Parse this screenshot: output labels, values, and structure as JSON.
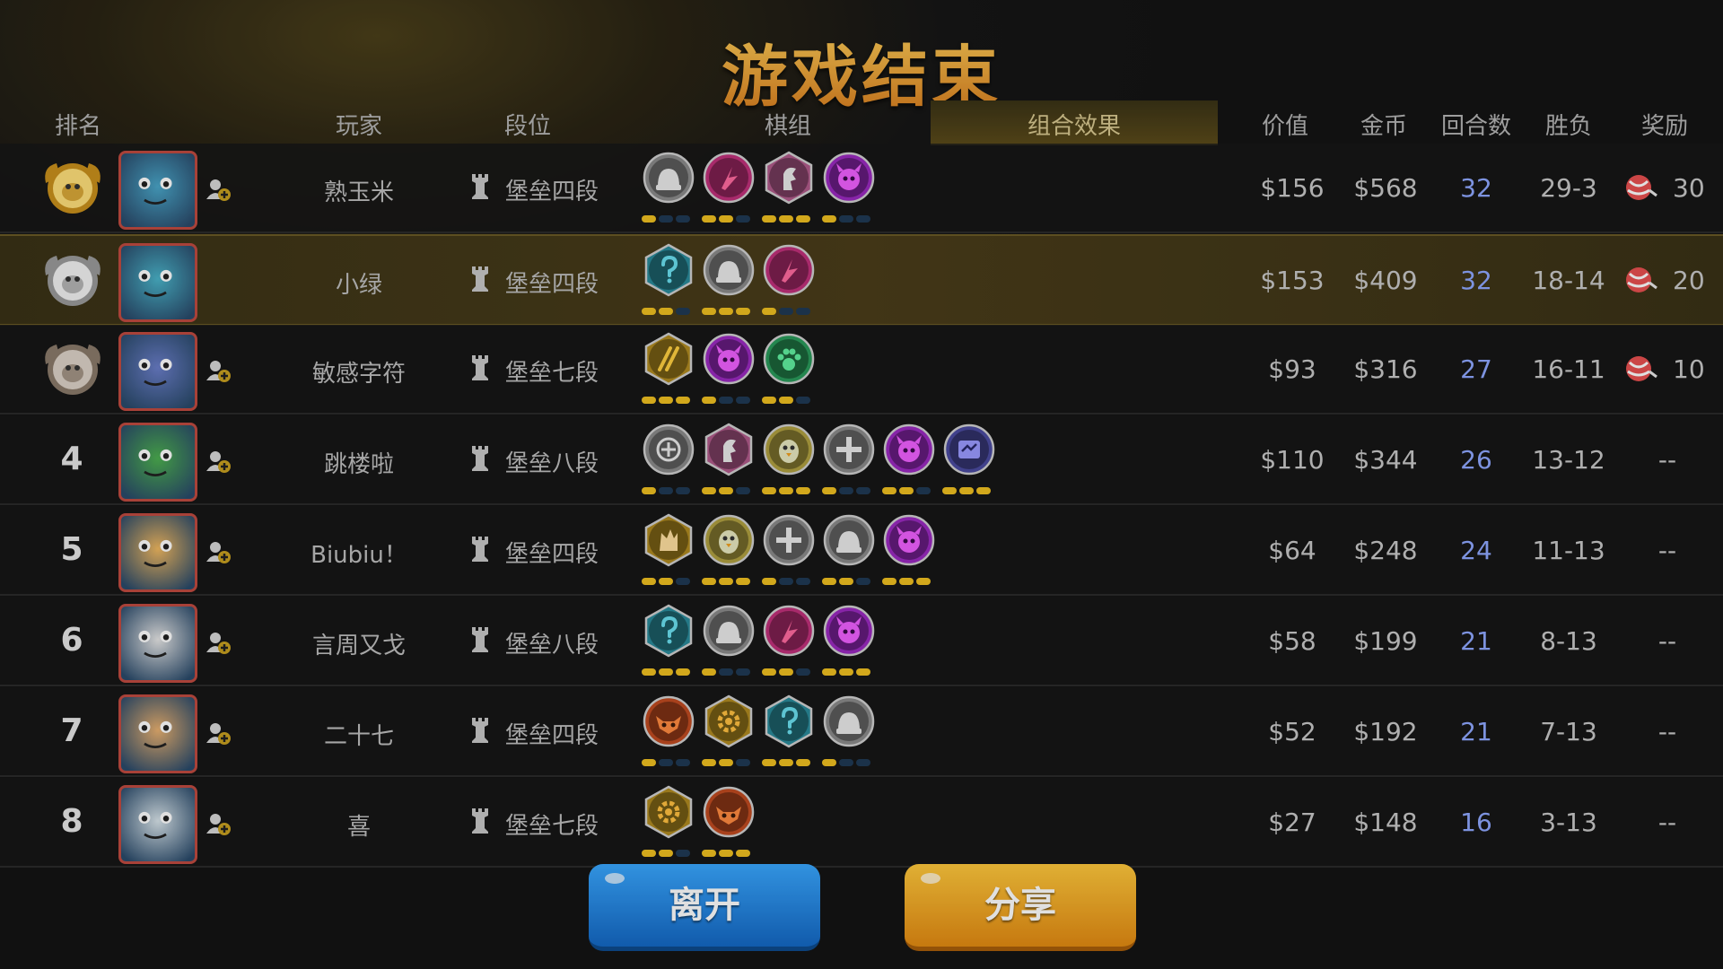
{
  "title": "游戏结束",
  "columns": {
    "rank": "排名",
    "player": "玩家",
    "tier": "段位",
    "lineup": "棋组",
    "synergy": "组合效果",
    "value": "价值",
    "gold": "金币",
    "rounds": "回合数",
    "record": "胜负",
    "reward": "奖励"
  },
  "players": [
    {
      "rank": "",
      "medal": "gold-medal",
      "name": "熟玉米",
      "tier": "堡垒四段",
      "value": "$156",
      "gold": "$568",
      "rounds": "32",
      "record": "29-3",
      "reward": "30",
      "friend": true,
      "avatar_color": "#4aa6c9"
    },
    {
      "rank": "",
      "medal": "silver-medal",
      "name": "小绿",
      "tier": "堡垒四段",
      "value": "$153",
      "gold": "$409",
      "rounds": "32",
      "record": "18-14",
      "reward": "20",
      "friend": false,
      "avatar_color": "#4ab3c9"
    },
    {
      "rank": "",
      "medal": "bronze-medal",
      "name": "敏感字符",
      "tier": "堡垒七段",
      "value": "$93",
      "gold": "$316",
      "rounds": "27",
      "record": "16-11",
      "reward": "10",
      "friend": true,
      "avatar_color": "#6a7ec9"
    },
    {
      "rank": "4",
      "medal": "",
      "name": "跳楼啦",
      "tier": "堡垒八段",
      "value": "$110",
      "gold": "$344",
      "rounds": "26",
      "record": "13-12",
      "reward": "--",
      "friend": true,
      "avatar_color": "#4caf50"
    },
    {
      "rank": "5",
      "medal": "",
      "name": "Biubiu！",
      "tier": "堡垒四段",
      "value": "$64",
      "gold": "$248",
      "rounds": "24",
      "record": "11-13",
      "reward": "--",
      "friend": true,
      "avatar_color": "#f0b860"
    },
    {
      "rank": "6",
      "medal": "",
      "name": "言周又戈",
      "tier": "堡垒八段",
      "value": "$58",
      "gold": "$199",
      "rounds": "21",
      "record": "8-13",
      "reward": "--",
      "friend": true,
      "avatar_color": "#e6e6e6"
    },
    {
      "rank": "7",
      "medal": "",
      "name": "二十七",
      "tier": "堡垒四段",
      "value": "$52",
      "gold": "$192",
      "rounds": "21",
      "record": "7-13",
      "reward": "--",
      "friend": true,
      "avatar_color": "#e8b070"
    },
    {
      "rank": "8",
      "medal": "",
      "name": "喜",
      "tier": "堡垒七段",
      "value": "$27",
      "gold": "$148",
      "rounds": "16",
      "record": "3-13",
      "reward": "--",
      "friend": true,
      "avatar_color": "#d8e4ea"
    }
  ],
  "traits_by_row": [
    [
      {
        "icon": "knight-helmet-icon",
        "color": "#8a8a8a"
      },
      {
        "icon": "dragon-icon",
        "color": "#c0307a"
      },
      {
        "icon": "horse-icon",
        "color": "#b05a8a"
      },
      {
        "icon": "demon-icon",
        "color": "#9a2ac0"
      }
    ],
    [
      {
        "icon": "mystery-icon",
        "color": "#2a8a9a"
      },
      {
        "icon": "knight-helmet-icon",
        "color": "#8a8a8a"
      },
      {
        "icon": "dragon-icon",
        "color": "#c0307a"
      }
    ],
    [
      {
        "icon": "blades-icon",
        "color": "#b08a20"
      },
      {
        "icon": "demon-icon",
        "color": "#9a2ac0"
      },
      {
        "icon": "paw-icon",
        "color": "#2a9a5a"
      }
    ],
    [
      {
        "icon": "goblin-icon",
        "color": "#8a8a8a"
      },
      {
        "icon": "horse-icon",
        "color": "#b05a8a"
      },
      {
        "icon": "penguin-icon",
        "color": "#b0a040"
      },
      {
        "icon": "cross-icon",
        "color": "#8a8a8a"
      },
      {
        "icon": "demon-icon",
        "color": "#9a2ac0"
      },
      {
        "icon": "shaman-icon",
        "color": "#4a4aa0"
      }
    ],
    [
      {
        "icon": "wolf-icon",
        "color": "#b08a20"
      },
      {
        "icon": "penguin-icon",
        "color": "#b0a040"
      },
      {
        "icon": "cross-icon",
        "color": "#8a8a8a"
      },
      {
        "icon": "knight-helmet-icon",
        "color": "#8a8a8a"
      },
      {
        "icon": "demon-icon",
        "color": "#9a2ac0"
      }
    ],
    [
      {
        "icon": "mystery-icon",
        "color": "#2a8a9a"
      },
      {
        "icon": "knight-helmet-icon",
        "color": "#8a8a8a"
      },
      {
        "icon": "dragon-icon",
        "color": "#c0307a"
      },
      {
        "icon": "demon-icon",
        "color": "#9a2ac0"
      }
    ],
    [
      {
        "icon": "beast-icon",
        "color": "#c04a20"
      },
      {
        "icon": "gear-icon",
        "color": "#b08a20"
      },
      {
        "icon": "mystery-icon",
        "color": "#2a8a9a"
      },
      {
        "icon": "knight-helmet-icon",
        "color": "#8a8a8a"
      }
    ],
    [
      {
        "icon": "gear-icon",
        "color": "#b08a20"
      },
      {
        "icon": "beast-icon",
        "color": "#c04a20"
      }
    ]
  ],
  "buttons": {
    "leave": "离开",
    "share": "分享"
  },
  "colors": {
    "title": "#f0a830",
    "accent_gold": "#f0c020",
    "rounds_blue": "#8fa8ff",
    "leave_blue": "#2a8ae0",
    "share_orange": "#f0a820"
  }
}
